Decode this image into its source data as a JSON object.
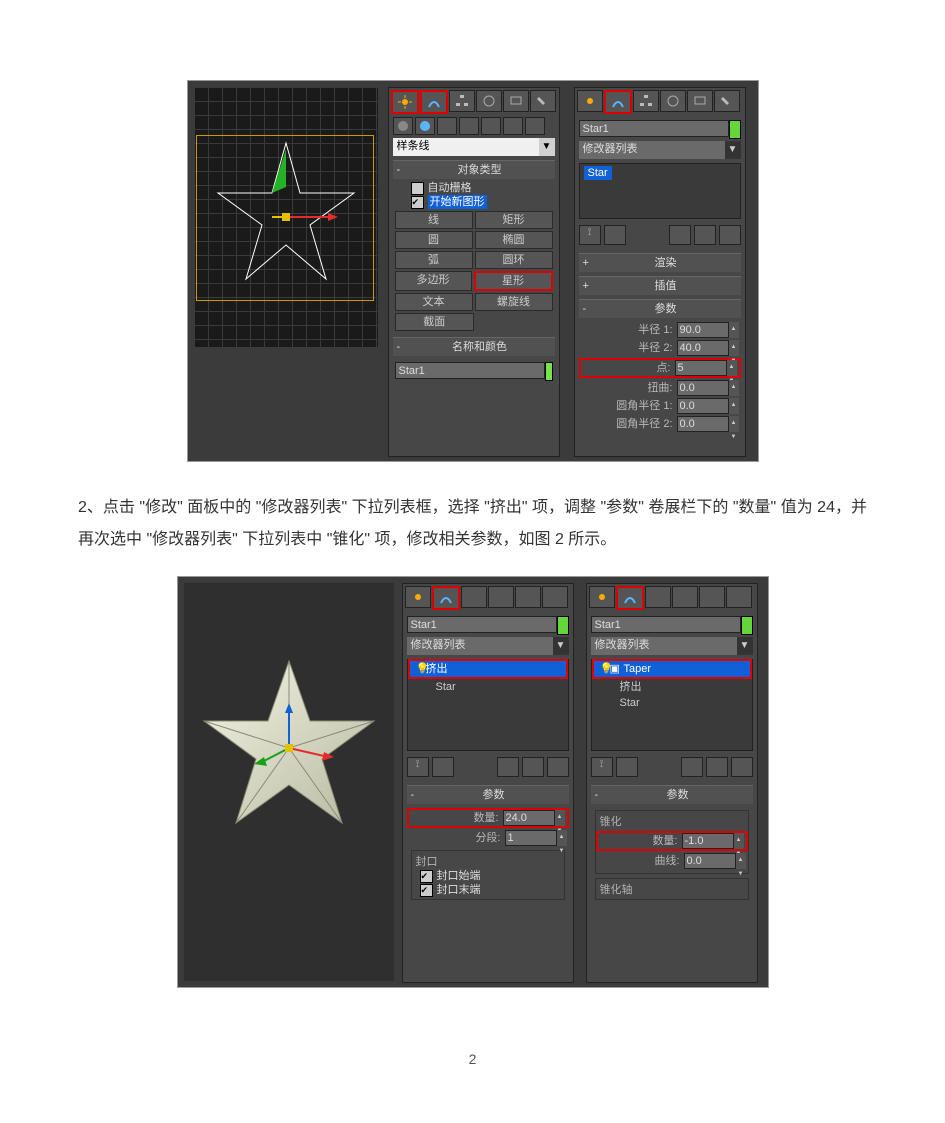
{
  "page_number": "2",
  "bodytext_step": "2、点击 \"修改\" 面板中的 \"修改器列表\" 下拉列表框，选择 \"挤出\" 项，调整 \"参数\" 卷展栏下的 \"数量\" 值为 24，并再次选中 \"修改器列表\" 下拉列表中 \"锥化\" 项，修改相关参数，如图 2 所示。",
  "fig1": {
    "panelA": {
      "dropdown": "样条线",
      "rollup_objecttype": "对象类型",
      "autogrid": "自动栅格",
      "beginnewshape": "开始新图形",
      "buttons": {
        "line": "线",
        "rectangle": "矩形",
        "circle": "圆",
        "ellipse": "椭圆",
        "arc": "弧",
        "donut": "圆环",
        "ngon": "多边形",
        "star": "星形",
        "text": "文本",
        "helix": "螺旋线",
        "section": "截面"
      },
      "rollup_namecolor": "名称和颜色",
      "name_value": "Star1"
    },
    "panelB": {
      "name_value": "Star1",
      "dropdown": "修改器列表",
      "stack_item": "Star",
      "rollups": {
        "render": "渲染",
        "interp": "插值",
        "params": "参数"
      },
      "params": {
        "radius1_label": "半径 1:",
        "radius1_val": "90.0",
        "radius2_label": "半径 2:",
        "radius2_val": "40.0",
        "points_label": "点:",
        "points_val": "5",
        "distort_label": "扭曲:",
        "distort_val": "0.0",
        "fillet1_label": "圆角半径 1:",
        "fillet1_val": "0.0",
        "fillet2_label": "圆角半径 2:",
        "fillet2_val": "0.0"
      }
    }
  },
  "fig2": {
    "name_value": "Star1",
    "dropdown": "修改器列表",
    "panelA": {
      "stack_top": "挤出",
      "stack_sub": "Star",
      "rollup_params": "参数",
      "amount_label": "数量:",
      "amount_val": "24.0",
      "seg_label": "分段:",
      "seg_val": "1",
      "cap_group": "封口",
      "cap_start": "封口始端",
      "cap_end": "封口末端"
    },
    "panelB": {
      "stack_top": "Taper",
      "stack_mid": "挤出",
      "stack_sub": "Star",
      "rollup_params": "参数",
      "taper_group": "锥化",
      "amount_label": "数量:",
      "amount_val": "-1.0",
      "curve_label": "曲线:",
      "curve_val": "0.0",
      "axis_group": "锥化轴"
    }
  }
}
